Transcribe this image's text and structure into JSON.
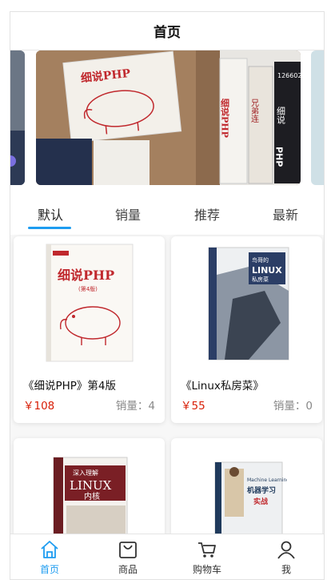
{
  "header": {
    "title": "首页"
  },
  "tabs": [
    {
      "label": "默认"
    },
    {
      "label": "销量"
    },
    {
      "label": "推荐"
    },
    {
      "label": "最新"
    }
  ],
  "products": [
    {
      "title": "《细说PHP》第4版",
      "price": "￥108",
      "sales": "销量：4",
      "cover_title": "细说PHP",
      "cover_edition": "(第4版)"
    },
    {
      "title": "《Linux私房菜》",
      "price": "￥55",
      "sales": "销量：0",
      "cover_title": "鸟哥的 LINUX 私房菜",
      "cover_edition": ""
    },
    {
      "title": "",
      "price": "",
      "sales": "",
      "cover_title": "深入理解 LINUX 内核",
      "cover_edition": ""
    },
    {
      "title": "",
      "price": "",
      "sales": "",
      "cover_title": "机器学习实战",
      "cover_edition": ""
    }
  ],
  "tabbar": [
    {
      "label": "首页",
      "icon": "home-icon"
    },
    {
      "label": "商品",
      "icon": "bag-icon"
    },
    {
      "label": "购物车",
      "icon": "cart-icon"
    },
    {
      "label": "我",
      "icon": "user-icon"
    }
  ],
  "colors": {
    "accent": "#1e9cf0",
    "price": "#d81e06",
    "muted": "#888888"
  }
}
